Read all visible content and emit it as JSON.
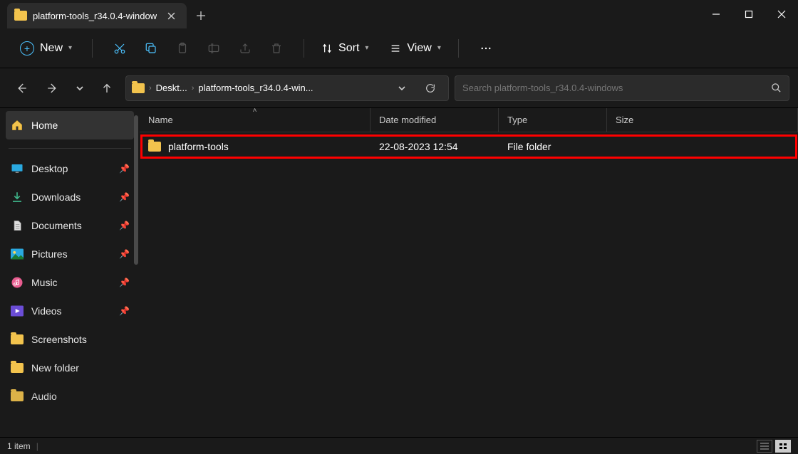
{
  "tab": {
    "title": "platform-tools_r34.0.4-window"
  },
  "toolbar": {
    "new_label": "New",
    "sort_label": "Sort",
    "view_label": "View"
  },
  "breadcrumb": {
    "item0": "Deskt...",
    "item1": "platform-tools_r34.0.4-win..."
  },
  "search": {
    "placeholder": "Search platform-tools_r34.0.4-windows"
  },
  "sidebar": {
    "home": "Home",
    "desktop": "Desktop",
    "downloads": "Downloads",
    "documents": "Documents",
    "pictures": "Pictures",
    "music": "Music",
    "videos": "Videos",
    "screenshots": "Screenshots",
    "newfolder": "New folder",
    "audio": "Audio"
  },
  "columns": {
    "name": "Name",
    "date": "Date modified",
    "type": "Type",
    "size": "Size"
  },
  "rows": [
    {
      "name": "platform-tools",
      "date": "22-08-2023 12:54",
      "type": "File folder",
      "size": ""
    }
  ],
  "status": {
    "count": "1 item"
  }
}
